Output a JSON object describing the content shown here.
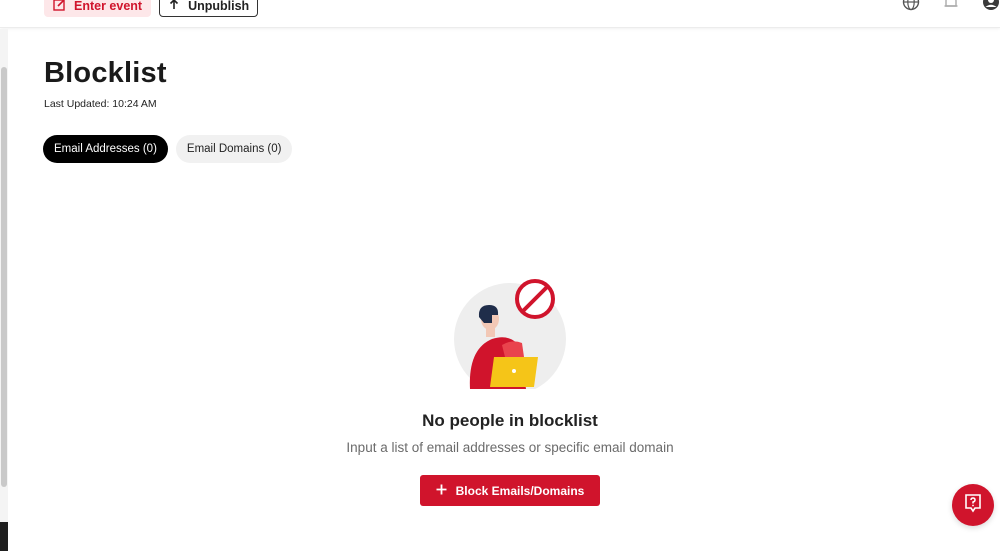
{
  "topbar": {
    "enter_event_label": "Enter event",
    "unpublish_label": "Unpublish",
    "icons": [
      "edit-icon",
      "upload-icon",
      "globe-icon",
      "bell-icon",
      "user-icon"
    ]
  },
  "page": {
    "title": "Blocklist",
    "last_updated": "Last Updated: 10:24 AM"
  },
  "tabs": [
    {
      "label": "Email Addresses (0)",
      "active": true
    },
    {
      "label": "Email Domains (0)",
      "active": false
    }
  ],
  "empty_state": {
    "title": "No people in blocklist",
    "description": "Input a list of email addresses or specific email domain",
    "button_label": "Block Emails/Domains"
  },
  "colors": {
    "brand_red": "#d0142c",
    "enter_bg": "#fde7e9",
    "active_tab_bg": "#000000",
    "inactive_tab_bg": "#f1f1f1",
    "laptop_yellow": "#f5c518"
  },
  "help": {
    "icon": "help-icon"
  }
}
